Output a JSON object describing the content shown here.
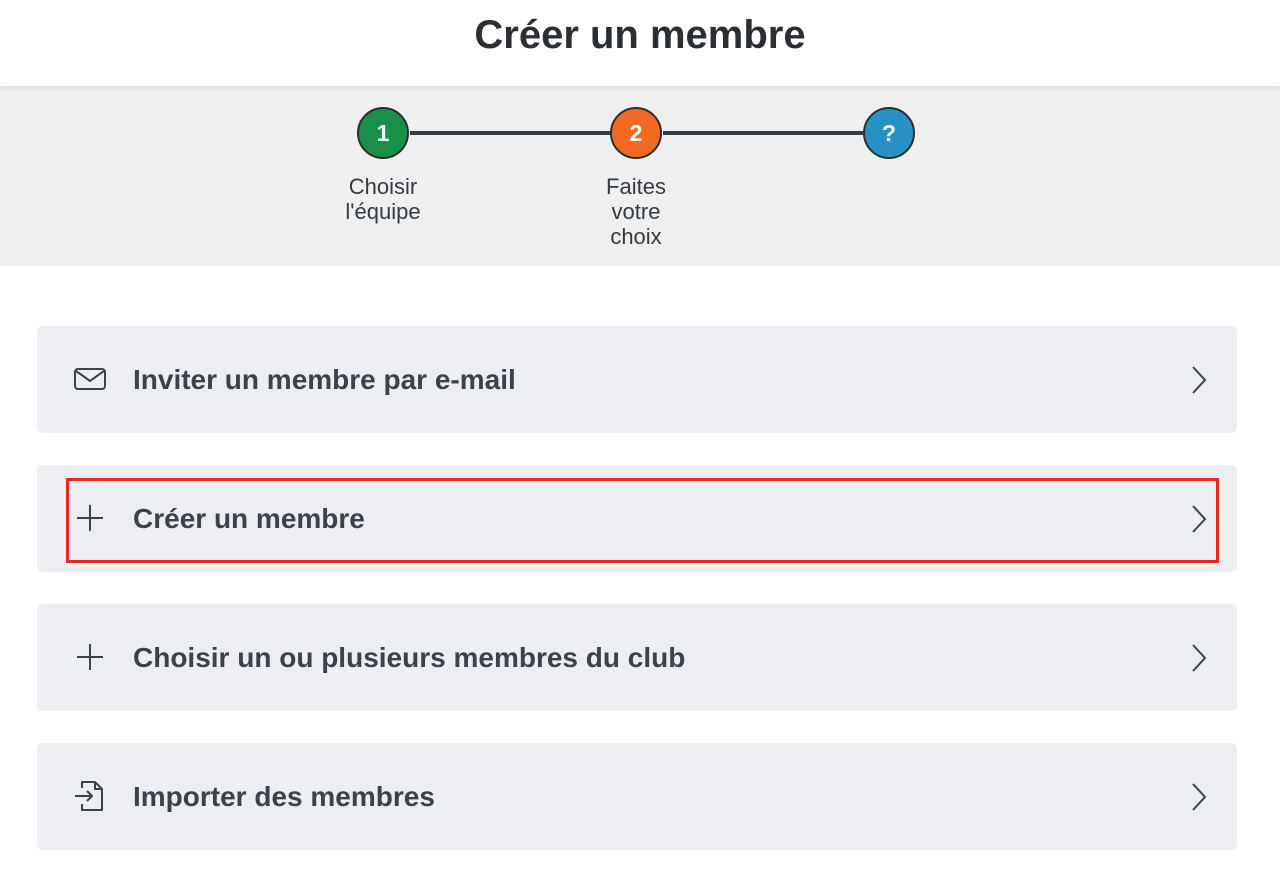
{
  "header": {
    "title": "Créer un membre"
  },
  "stepper": {
    "steps": [
      {
        "number": "1",
        "label_lines": [
          "Choisir",
          "l'équipe"
        ],
        "color": "#1a8f48"
      },
      {
        "number": "2",
        "label_lines": [
          "Faites",
          "votre",
          "choix"
        ],
        "color": "#f26a22"
      },
      {
        "number": "?",
        "label_lines": [],
        "color": "#2592c3"
      }
    ],
    "line_color": "#333b42"
  },
  "options": [
    {
      "label": "Inviter un membre par e-mail",
      "icon": "envelope-icon"
    },
    {
      "label": "Créer un membre",
      "icon": "plus-icon",
      "highlighted": true,
      "highlight_color": "#e8281f"
    },
    {
      "label": "Choisir un ou plusieurs membres du club",
      "icon": "plus-icon"
    },
    {
      "label": "Importer des membres",
      "icon": "file-import-icon"
    }
  ],
  "colors": {
    "card_background": "#edeef2",
    "band_background": "#efefef",
    "text": "#3a434c"
  }
}
